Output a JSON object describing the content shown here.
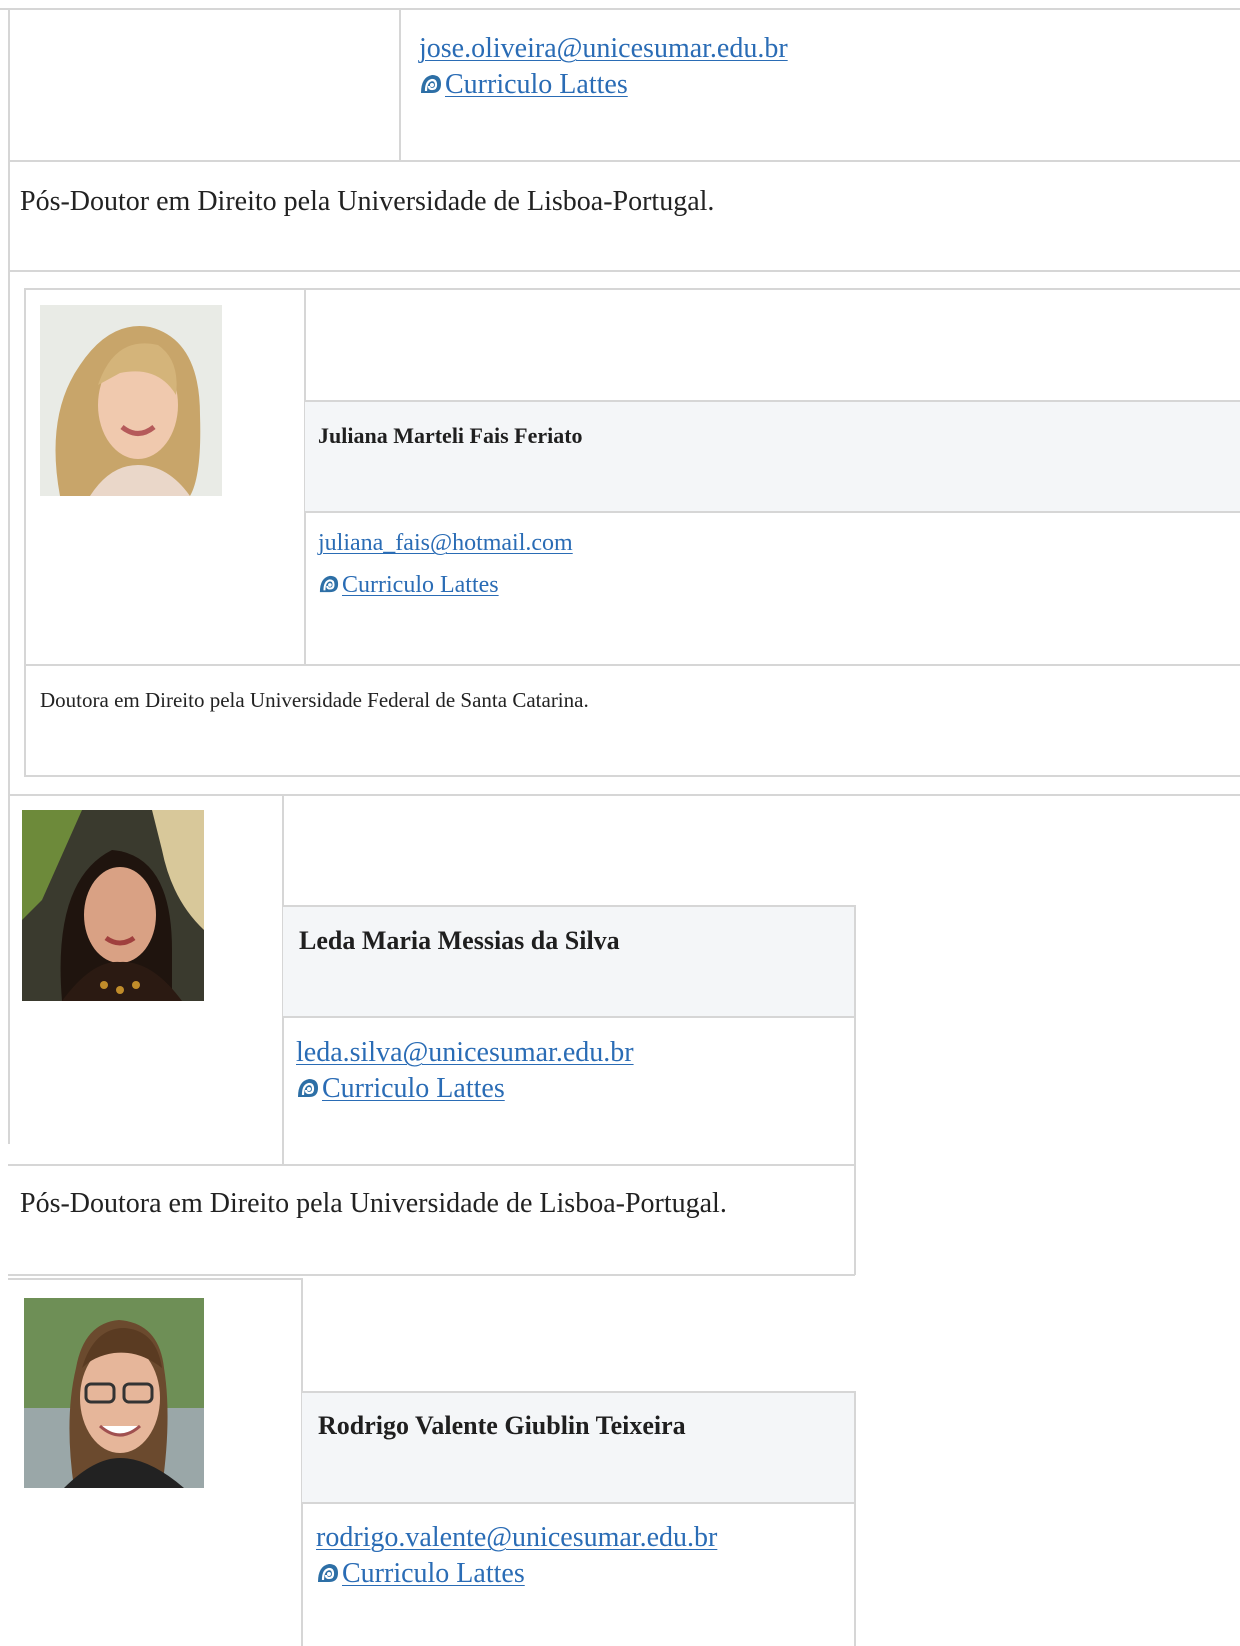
{
  "entries": [
    {
      "email": "jose.oliveira@unicesumar.edu.br",
      "lattes_label": "Curriculo Lattes",
      "degree": "Pós-Doutor em Direito pela Universidade de Lisboa-Portugal."
    },
    {
      "name": "Juliana Marteli Fais Feriato",
      "email": "juliana_fais@hotmail.com",
      "lattes_label": "Curriculo Lattes",
      "degree": "Doutora em Direito pela Universidade Federal de Santa Catarina."
    },
    {
      "name": "Leda Maria Messias da Silva",
      "email": "leda.silva@unicesumar.edu.br",
      "lattes_label": "Curriculo Lattes",
      "degree": "Pós-Doutora em Direito pela Universidade de Lisboa-Portugal."
    },
    {
      "name": "Rodrigo Valente Giublin Teixeira",
      "email": "rodrigo.valente@unicesumar.edu.br",
      "lattes_label": "Curriculo Lattes"
    }
  ],
  "icons": {
    "lattes": "lattes-logo-icon"
  },
  "colors": {
    "link": "#2a6cb5",
    "header_fill": "#f4f6f8",
    "border": "#d6d6d6"
  }
}
